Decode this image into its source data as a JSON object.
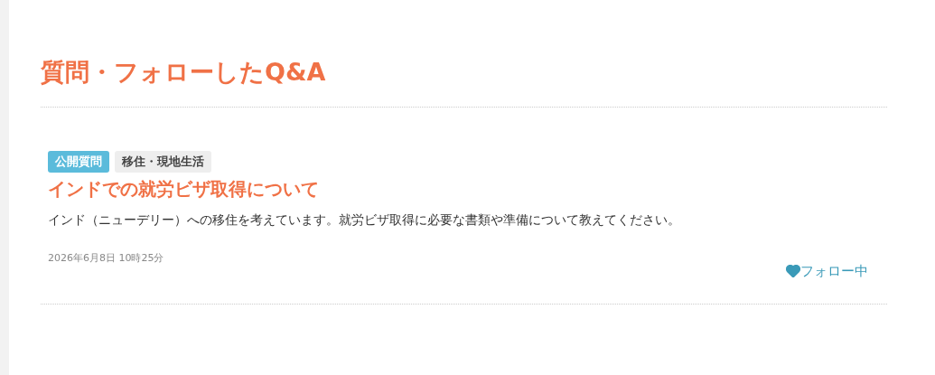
{
  "page_title": "質問・フォローしたQ&A",
  "questions": [
    {
      "tags": [
        {
          "kind": "status",
          "label": "公開質問"
        },
        {
          "kind": "category",
          "label": "移住・現地生活"
        }
      ],
      "title": "インドでの就労ビザ取得について",
      "body": "インド（ニューデリー）への移住を考えています。就労ビザ取得に必要な書類や準備について教えてください。",
      "date": "2026年6月8日 10時25分",
      "follow": {
        "label": "フォロー中",
        "following": true
      }
    }
  ]
}
